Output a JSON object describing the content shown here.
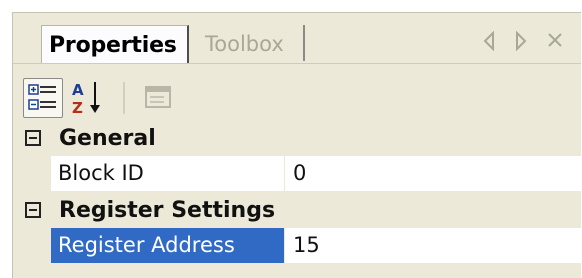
{
  "tabs": [
    {
      "label": "Properties",
      "active": true
    },
    {
      "label": "Toolbox",
      "active": false
    }
  ],
  "window_controls": [
    "nav-left-icon",
    "nav-right-icon",
    "close-icon"
  ],
  "toolbar": {
    "buttons": [
      {
        "icon": "categorized-icon",
        "pressed": true
      },
      {
        "icon": "alphabetical-sort-icon",
        "pressed": false
      },
      {
        "icon": "property-pages-icon",
        "pressed": false,
        "enabled": false
      }
    ],
    "sort_letters": {
      "top": "A",
      "bottom": "Z"
    }
  },
  "grid": {
    "categories": [
      {
        "name": "General",
        "expanded": true,
        "properties": [
          {
            "name": "Block ID",
            "value": "0",
            "selected": false
          }
        ]
      },
      {
        "name": "Register Settings",
        "expanded": true,
        "properties": [
          {
            "name": "Register Address",
            "value": "15",
            "selected": true
          }
        ]
      }
    ]
  },
  "colors": {
    "panel": "#ece9d8",
    "selection": "#316ac5",
    "inactive_text": "#a9a796"
  }
}
